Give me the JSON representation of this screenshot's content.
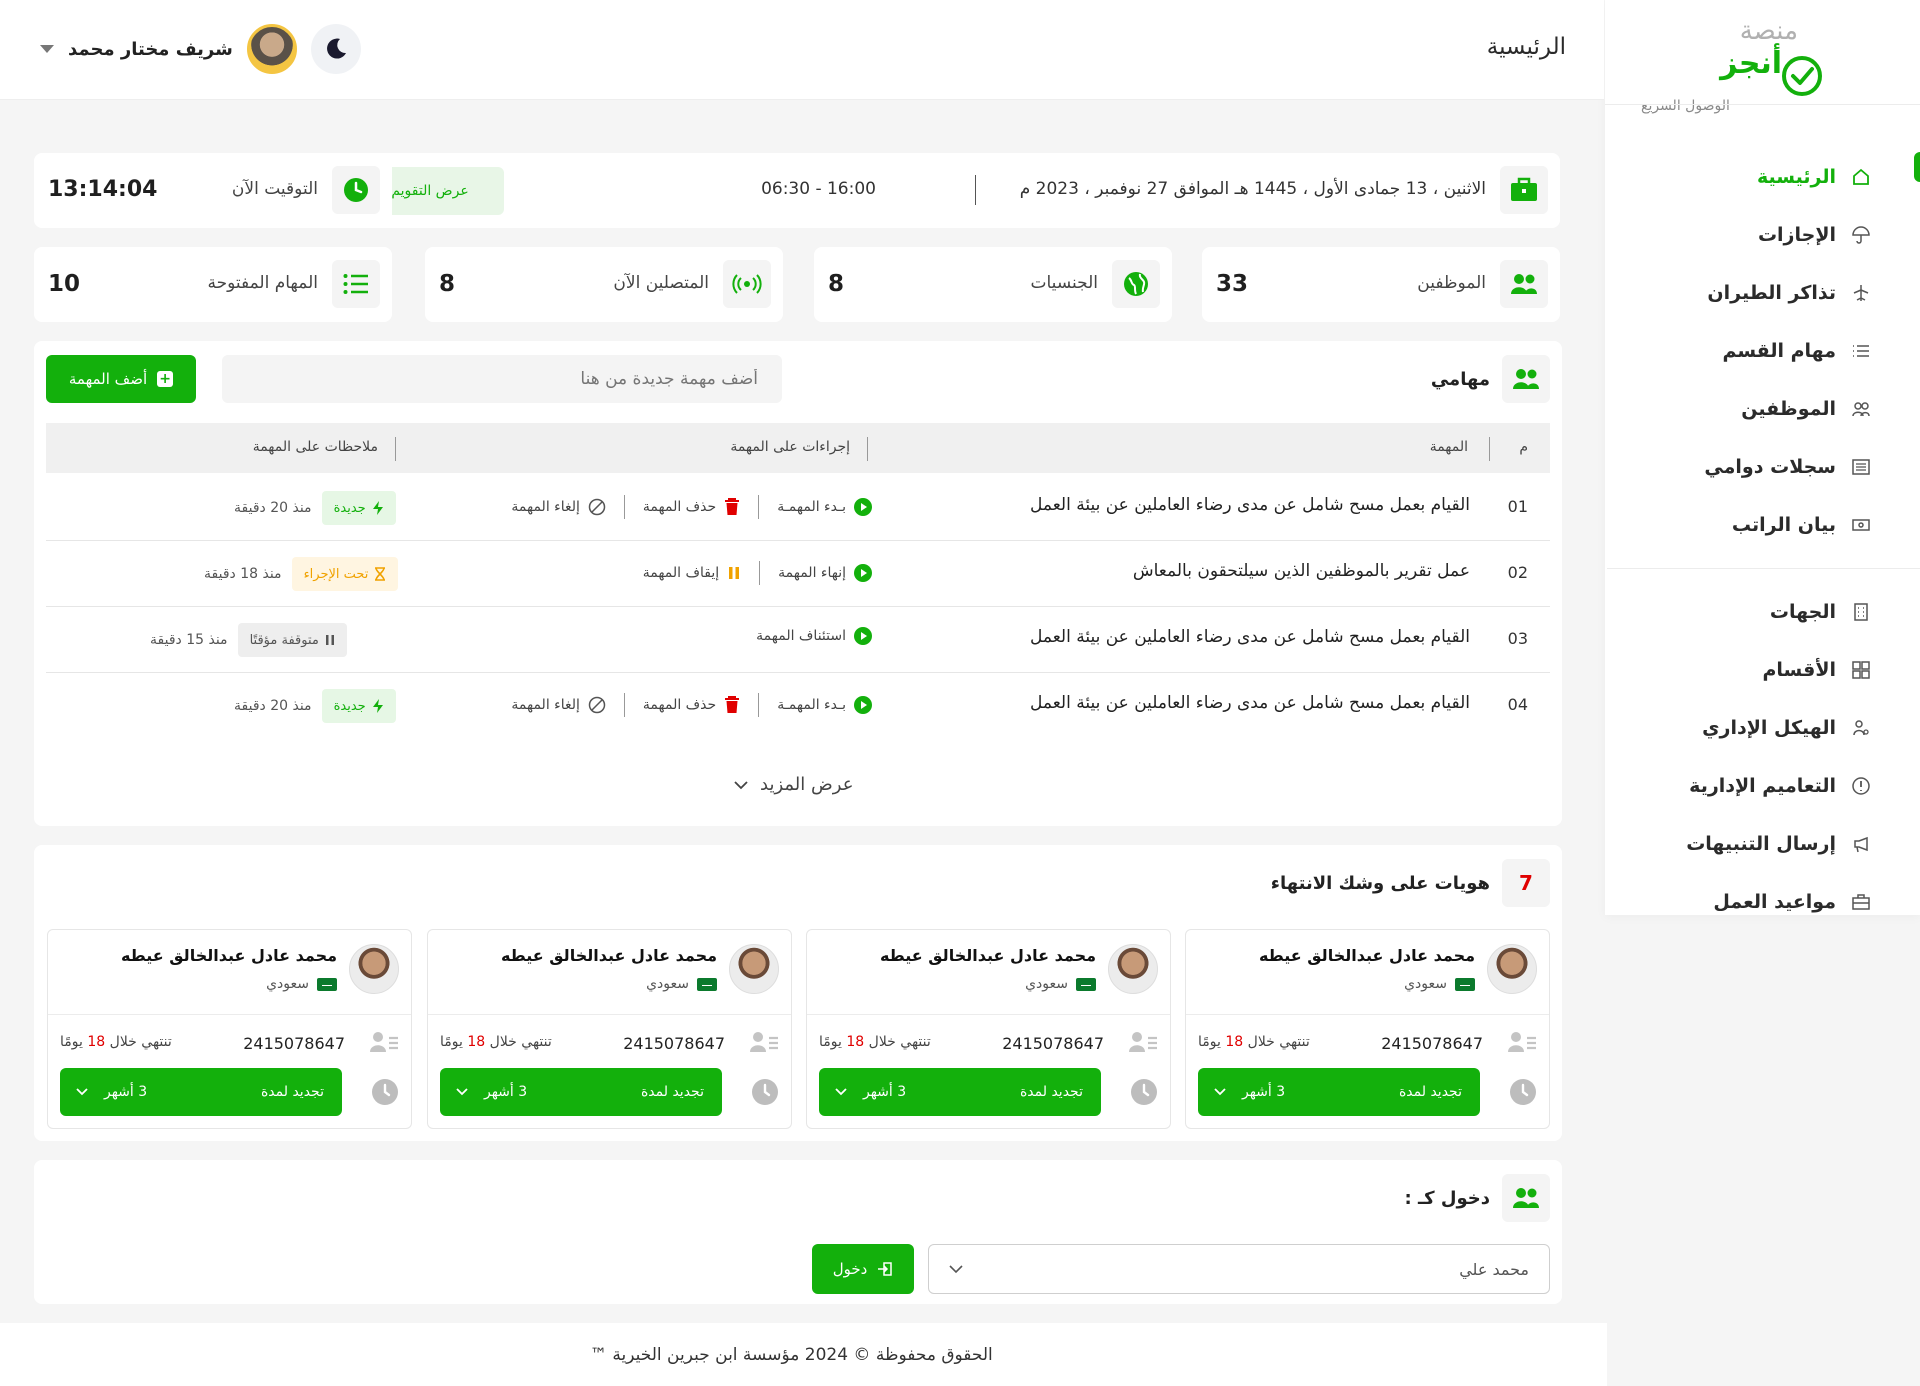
{
  "brand": {
    "top": "منصة",
    "main": "أنجز"
  },
  "sidebar": {
    "quick_access": "الوصول السريع",
    "items": [
      {
        "label": "الرئيسية",
        "icon": "home-icon"
      },
      {
        "label": "الإجازات",
        "icon": "umbrella-icon"
      },
      {
        "label": "تذاكر الطيران",
        "icon": "plane-icon"
      },
      {
        "label": "مهام القسم",
        "icon": "list-icon"
      },
      {
        "label": "الموظفين",
        "icon": "users-icon"
      },
      {
        "label": "سجلات دوامي",
        "icon": "log-icon"
      },
      {
        "label": "بيان الراتب",
        "icon": "money-icon"
      }
    ],
    "items2": [
      {
        "label": "الجهات",
        "icon": "building-icon"
      },
      {
        "label": "الأقسام",
        "icon": "grid-icon"
      },
      {
        "label": "الهيكل الإداري",
        "icon": "org-icon"
      },
      {
        "label": "التعاميم الإدارية",
        "icon": "info-icon"
      },
      {
        "label": "إرسال التنبيهات",
        "icon": "megaphone-icon"
      },
      {
        "label": "مواعيد العمل",
        "icon": "briefcase-icon"
      }
    ]
  },
  "header": {
    "title": "الرئيسية",
    "user_name": "شريف مختار محمد"
  },
  "date_bar": {
    "date": "الاثنين ، 13 جمادى الأول ، 1445 هـ الموافق 27 نوفمبر ، 2023 م",
    "shift": "06:30 - 16:00",
    "calendar_button": "عرض التقويم"
  },
  "time": {
    "label": "التوقيت الآن",
    "value": "13:14:04"
  },
  "stats": [
    {
      "label": "الموظفين",
      "value": "33"
    },
    {
      "label": "الجنسيات",
      "value": "8"
    },
    {
      "label": "المتصلين الآن",
      "value": "8"
    },
    {
      "label": "المهام المفتوحة",
      "value": "10"
    }
  ],
  "tasks": {
    "title": "مهامي",
    "input_placeholder": "أضف مهمة جديدة من هنا",
    "add_button": "أضف المهمة",
    "columns": {
      "num": "م",
      "task": "المهمة",
      "actions": "إجراءات على المهمة",
      "notes": "ملاحظات على المهمة"
    },
    "rows": [
      {
        "num": "01",
        "title": "القيام بعمل مسح شامل عن مدى رضاء العاملين عن بيئة العمل",
        "a1": "بـدء المهمـة",
        "a2": "حذف المهمة",
        "a3": "إلغاء المهمة",
        "badge": "جديدة",
        "since": "منذ 20 دقيقة"
      },
      {
        "num": "02",
        "title": "عمل تقرير بالموظفين الذين سيلتحقون بالمعاش",
        "a1": "إنهاء المهمة",
        "a2": "إيقاف المهمة",
        "badge": "تحت الإجراء",
        "since": "منذ 18 دقيقة"
      },
      {
        "num": "03",
        "title": "القيام بعمل مسح شامل عن مدى رضاء العاملين عن بيئة العمل",
        "a1": "استئناف المهمة",
        "badge": "متوقفة مؤقتًا",
        "since": "منذ 15 دقيقة"
      },
      {
        "num": "04",
        "title": "القيام بعمل مسح شامل عن مدى رضاء العاملين عن بيئة العمل",
        "a1": "بـدء المهمـة",
        "a2": "حذف المهمة",
        "a3": "إلغاء المهمة",
        "badge": "جديدة",
        "since": "منذ 20 دقيقة"
      }
    ],
    "show_more": "عرض المزيد"
  },
  "ids": {
    "count": "7",
    "title": "هويات على وشك الانتهاء",
    "cards": [
      {
        "name": "محمد عادل عبدالخالق عيطه",
        "nationality": "سعودي",
        "id_number": "2415078647",
        "expires_pre": "تنتهي خلال",
        "days": "18",
        "expires_post": "يومًا",
        "renew": "تجديد لمدة",
        "duration": "3 أشهر"
      },
      {
        "name": "محمد عادل عبدالخالق عيطه",
        "nationality": "سعودي",
        "id_number": "2415078647",
        "expires_pre": "تنتهي خلال",
        "days": "18",
        "expires_post": "يومًا",
        "renew": "تجديد لمدة",
        "duration": "3 أشهر"
      },
      {
        "name": "محمد عادل عبدالخالق عيطه",
        "nationality": "سعودي",
        "id_number": "2415078647",
        "expires_pre": "تنتهي خلال",
        "days": "18",
        "expires_post": "يومًا",
        "renew": "تجديد لمدة",
        "duration": "3 أشهر"
      },
      {
        "name": "محمد عادل عبدالخالق عيطه",
        "nationality": "سعودي",
        "id_number": "2415078647",
        "expires_pre": "تنتهي خلال",
        "days": "18",
        "expires_post": "يومًا",
        "renew": "تجديد لمدة",
        "duration": "3 أشهر"
      }
    ]
  },
  "login_as": {
    "title": "دخول كـ :",
    "selected": "محمد علي",
    "button": "دخول"
  },
  "footer": {
    "text": "الحقوق محفوظة © 2024 مؤسسة ابن جبرين الخيرية ™"
  },
  "colors": {
    "accent": "#13b00c",
    "danger": "#e00000",
    "warning": "#f0a200"
  }
}
